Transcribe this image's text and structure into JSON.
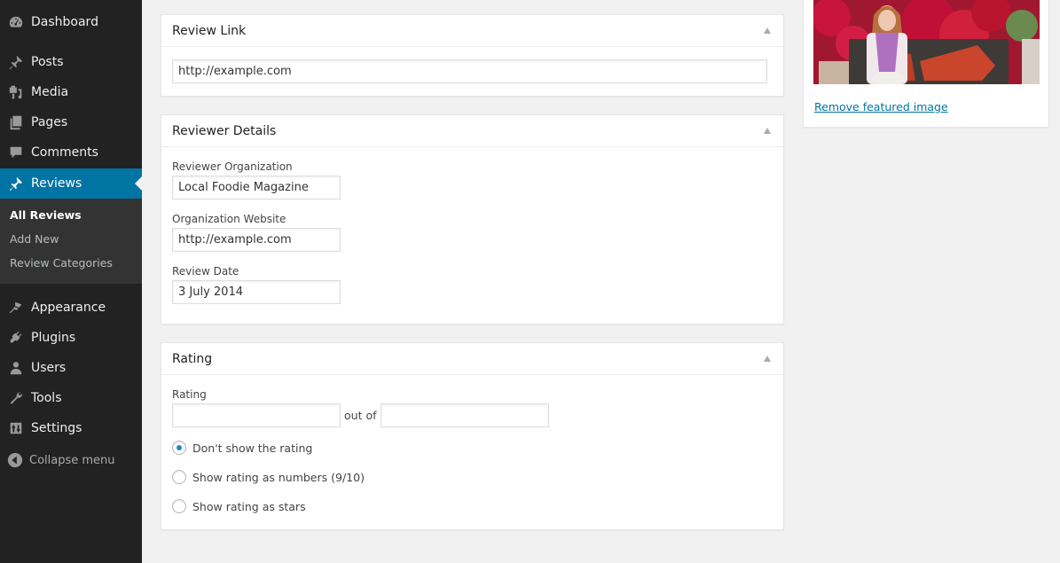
{
  "sidebar": {
    "items": [
      {
        "label": "Dashboard",
        "icon": "dashboard-icon"
      },
      {
        "label": "Posts",
        "icon": "pushpin-icon"
      },
      {
        "label": "Media",
        "icon": "media-icon"
      },
      {
        "label": "Pages",
        "icon": "pages-icon"
      },
      {
        "label": "Comments",
        "icon": "comment-icon"
      },
      {
        "label": "Reviews",
        "icon": "pushpin-icon",
        "active": true
      },
      {
        "label": "Appearance",
        "icon": "paintbrush-icon"
      },
      {
        "label": "Plugins",
        "icon": "plugin-icon"
      },
      {
        "label": "Users",
        "icon": "user-icon"
      },
      {
        "label": "Tools",
        "icon": "wrench-icon"
      },
      {
        "label": "Settings",
        "icon": "settings-icon"
      }
    ],
    "submenu": [
      {
        "label": "All Reviews",
        "current": true
      },
      {
        "label": "Add New"
      },
      {
        "label": "Review Categories"
      }
    ],
    "collapse_label": "Collapse menu"
  },
  "review_link": {
    "title": "Review Link",
    "url_value": "http://example.com"
  },
  "reviewer_details": {
    "title": "Reviewer Details",
    "org_label": "Reviewer Organization",
    "org_value": "Local Foodie Magazine",
    "website_label": "Organization Website",
    "website_value": "http://example.com",
    "date_label": "Review Date",
    "date_value": "3 July 2014"
  },
  "rating": {
    "title": "Rating",
    "rating_label": "Rating",
    "rating_value": "",
    "out_of_label": "out of",
    "out_of_value": "",
    "options": [
      {
        "label": "Don't show the rating",
        "checked": true
      },
      {
        "label": "Show rating as numbers (9/10)",
        "checked": false
      },
      {
        "label": "Show rating as stars",
        "checked": false
      }
    ]
  },
  "featured_image": {
    "remove_label": "Remove featured image"
  },
  "colors": {
    "sidebar_bg": "#222222",
    "active_menu": "#0074a2",
    "submenu_bg": "#333333",
    "link": "#0074a2",
    "radio_dot": "#1e8cbe"
  }
}
